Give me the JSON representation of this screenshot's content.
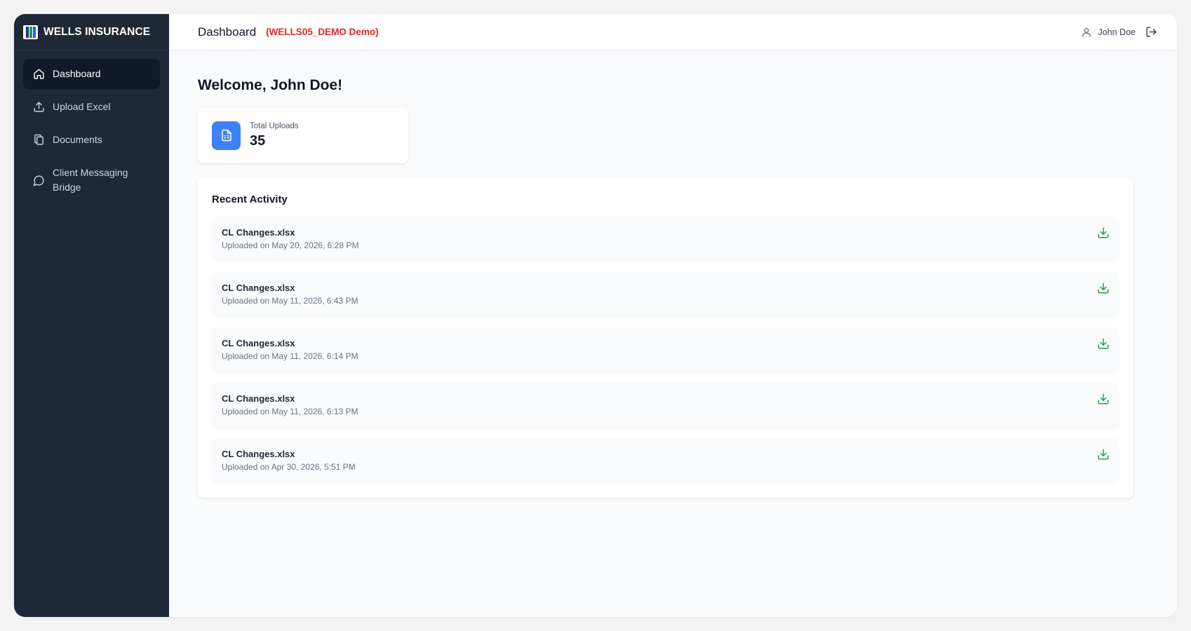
{
  "brand": {
    "name": "WELLS INSURANCE"
  },
  "sidebar": {
    "items": [
      {
        "label": "Dashboard",
        "icon": "home-icon",
        "active": true
      },
      {
        "label": "Upload Excel",
        "icon": "upload-icon",
        "active": false
      },
      {
        "label": "Documents",
        "icon": "documents-icon",
        "active": false
      },
      {
        "label": "Client Messaging Bridge",
        "icon": "chat-icon",
        "active": false
      }
    ]
  },
  "header": {
    "title": "Dashboard",
    "demo_label": "(WELLS05_DEMO Demo)",
    "user_name": "John Doe",
    "user_icon": "user-icon",
    "logout_icon": "logout-icon"
  },
  "main": {
    "welcome": "Welcome, John Doe!",
    "stats": {
      "total_uploads_label": "Total Uploads",
      "total_uploads_value": "35",
      "icon": "spreadsheet-icon"
    },
    "recent_activity": {
      "title": "Recent Activity",
      "items": [
        {
          "file": "CL Changes.xlsx",
          "date": "Uploaded on May 20, 2026, 6:28 PM"
        },
        {
          "file": "CL Changes.xlsx",
          "date": "Uploaded on May 11, 2026, 6:43 PM"
        },
        {
          "file": "CL Changes.xlsx",
          "date": "Uploaded on May 11, 2026, 6:14 PM"
        },
        {
          "file": "CL Changes.xlsx",
          "date": "Uploaded on May 11, 2026, 6:13 PM"
        },
        {
          "file": "CL Changes.xlsx",
          "date": "Uploaded on Apr 30, 2026, 5:51 PM"
        }
      ],
      "download_icon": "download-icon"
    }
  },
  "colors": {
    "sidebar_bg": "#1e2937",
    "sidebar_active": "#111827",
    "accent_blue": "#3b82f6",
    "demo_red": "#dc2626",
    "download_green": "#16a34a"
  }
}
